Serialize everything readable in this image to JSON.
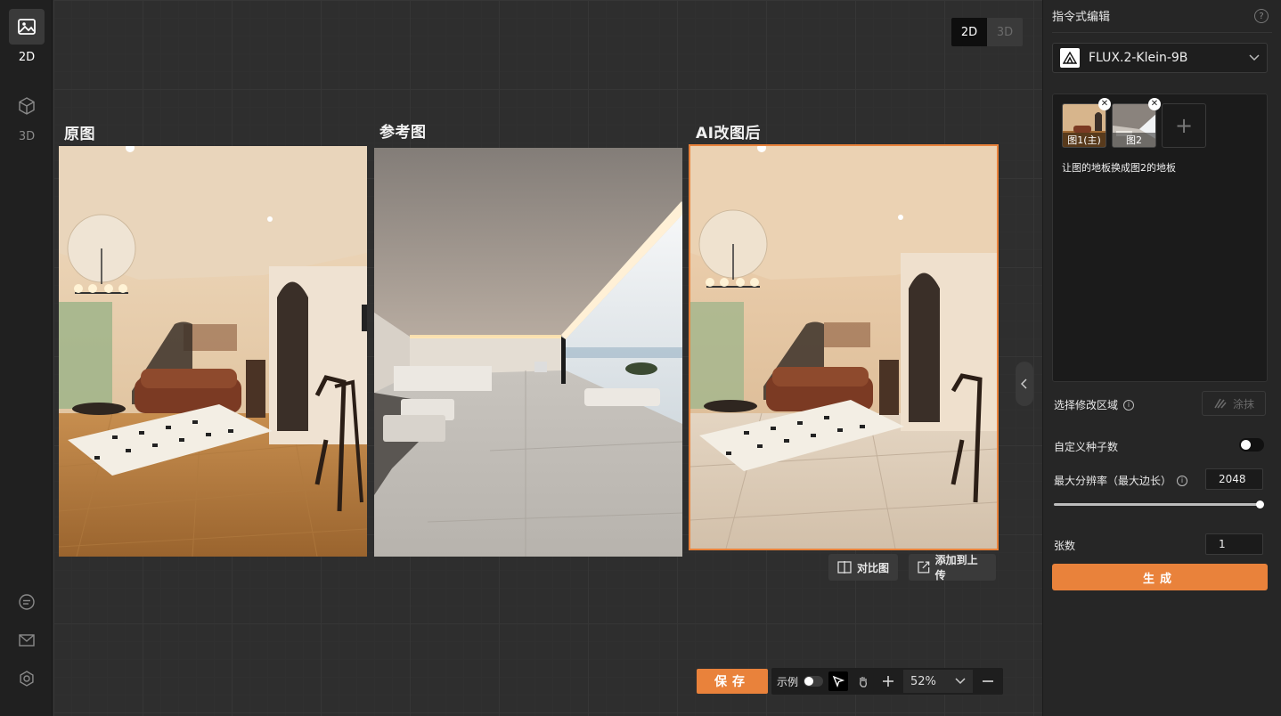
{
  "rail": {
    "items": [
      {
        "label": "2D",
        "icon": "image-icon",
        "active": true
      },
      {
        "label": "3D",
        "icon": "cube-icon",
        "active": false
      }
    ],
    "bottom_icons": [
      "chat-icon",
      "mail-icon",
      "settings-icon"
    ]
  },
  "canvas": {
    "mode_toggle": {
      "option_2d": "2D",
      "option_3d": "3D",
      "selected": "2D"
    },
    "panels": [
      {
        "title": "原图"
      },
      {
        "title": "参考图"
      },
      {
        "title": "AI改图后",
        "selected": true
      }
    ],
    "actions": {
      "compare": "对比图",
      "add_upload": "添加到上传"
    },
    "bottombar": {
      "save": "保存",
      "example": "示例",
      "zoom": "52%"
    }
  },
  "right_panel": {
    "title": "指令式编辑",
    "model": "FLUX.2-Klein-9B",
    "thumbnails": [
      {
        "label": "图1(主)"
      },
      {
        "label": "图2"
      }
    ],
    "prompt": "让图的地板换成图2的地板",
    "region_label": "选择修改区域",
    "smear_button": "涂抹",
    "seed_label": "自定义种子数",
    "resolution_label": "最大分辨率（最大边长）",
    "resolution_value": "2048",
    "resolution_slider_fraction": 1.0,
    "count_label": "张数",
    "count_value": "1",
    "generate": "生成"
  },
  "colors": {
    "accent": "#e9823b",
    "selection_border": "#e9823b"
  }
}
